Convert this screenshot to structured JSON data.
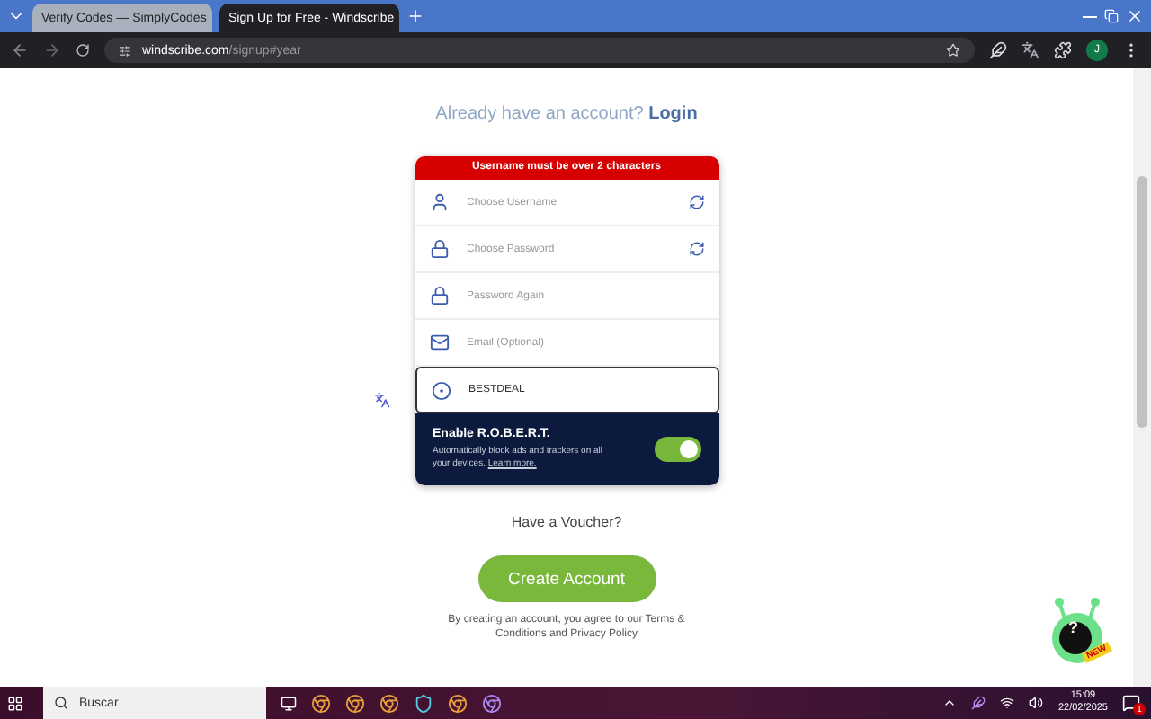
{
  "browser": {
    "tabs": [
      {
        "title": "Verify Codes — SimplyCodes",
        "selected": false
      },
      {
        "title": "Sign Up for Free - Windscribe",
        "selected": true
      }
    ],
    "url_host": "windscribe.com",
    "url_path": "/signup#year",
    "profile_initial": "J"
  },
  "page": {
    "login_prompt": "Already have an account?",
    "login_link": "Login",
    "error": "Username must be over 2 characters",
    "fields": [
      {
        "kind": "user",
        "placeholder": "Choose Username",
        "generate": true,
        "focused": false
      },
      {
        "kind": "lock",
        "placeholder": "Choose Password",
        "generate": true,
        "focused": false
      },
      {
        "kind": "lock",
        "placeholder": "Password Again",
        "generate": false,
        "focused": false
      },
      {
        "kind": "mail",
        "placeholder": "Email (Optional)",
        "generate": false,
        "focused": false
      },
      {
        "kind": "voucher",
        "value": "BESTDEAL",
        "generate": false,
        "focused": true
      }
    ],
    "robert": {
      "title": "Enable R.O.B.E.R.T.",
      "description": "Automatically block ads and trackers on all your devices.",
      "link": "Learn more.",
      "on": true
    },
    "voucher_link": "Have a Voucher?",
    "submit": "Create Account",
    "terms": "By creating an account, you agree to our Terms & Conditions and Privacy Policy",
    "mascot": {
      "symbol": "?",
      "badge": "NEW"
    }
  },
  "taskbar": {
    "search": "Buscar",
    "time": "15:09",
    "date": "22/02/2025",
    "notifications": "1"
  }
}
